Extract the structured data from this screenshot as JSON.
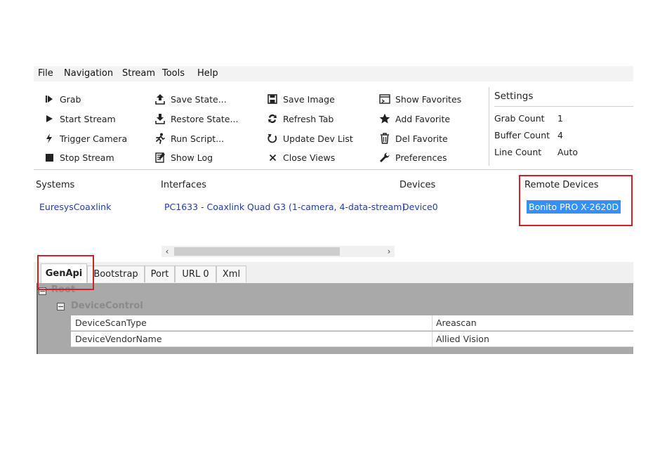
{
  "menu": [
    "File",
    "Navigation",
    "Stream",
    "Tools",
    "Help"
  ],
  "toolbar": {
    "col1": [
      {
        "label": "Grab",
        "icon": "grab-icon"
      },
      {
        "label": "Start Stream",
        "icon": "play-icon"
      },
      {
        "label": "Trigger Camera",
        "icon": "lightning-icon"
      },
      {
        "label": "Stop Stream",
        "icon": "stop-icon"
      }
    ],
    "col2": [
      {
        "label": "Save State...",
        "icon": "upload-icon"
      },
      {
        "label": "Restore State...",
        "icon": "download-icon"
      },
      {
        "label": "Run Script...",
        "icon": "run-icon"
      },
      {
        "label": "Show Log",
        "icon": "log-icon"
      }
    ],
    "col3": [
      {
        "label": "Save Image",
        "icon": "floppy-icon"
      },
      {
        "label": "Refresh Tab",
        "icon": "refresh-icon"
      },
      {
        "label": "Update Dev List",
        "icon": "update-icon"
      },
      {
        "label": "Close Views",
        "icon": "close-icon"
      }
    ],
    "col4": [
      {
        "label": "Show Favorites",
        "icon": "favorites-window-icon"
      },
      {
        "label": "Add Favorite",
        "icon": "star-icon"
      },
      {
        "label": "Del Favorite",
        "icon": "trash-icon"
      },
      {
        "label": "Preferences",
        "icon": "wrench-icon"
      }
    ]
  },
  "settings": {
    "title": "Settings",
    "rows": [
      {
        "label": "Grab Count",
        "value": "1"
      },
      {
        "label": "Buffer Count",
        "value": "4"
      },
      {
        "label": "Line Count",
        "value": "Auto"
      }
    ]
  },
  "columns": {
    "systems": {
      "header": "Systems",
      "value": "EuresysCoaxlink"
    },
    "interfaces": {
      "header": "Interfaces",
      "value": "PC1633 - Coaxlink Quad G3 (1-camera, 4-data-stream)"
    },
    "devices": {
      "header": "Devices",
      "value": "Device0"
    },
    "remote": {
      "header": "Remote Devices",
      "value": "Bonito PRO X-2620D"
    }
  },
  "tabs": [
    "GenApi",
    "Bootstrap",
    "Port",
    "URL 0",
    "Xml"
  ],
  "tree": {
    "root": "Root",
    "category": "DeviceControl",
    "properties": [
      {
        "name": "DeviceScanType",
        "value": "Areascan"
      },
      {
        "name": "DeviceVendorName",
        "value": "Allied Vision"
      }
    ]
  },
  "colors": {
    "highlight": "#d2202b",
    "selection": "#3390ff",
    "link": "#1f3fa8"
  }
}
